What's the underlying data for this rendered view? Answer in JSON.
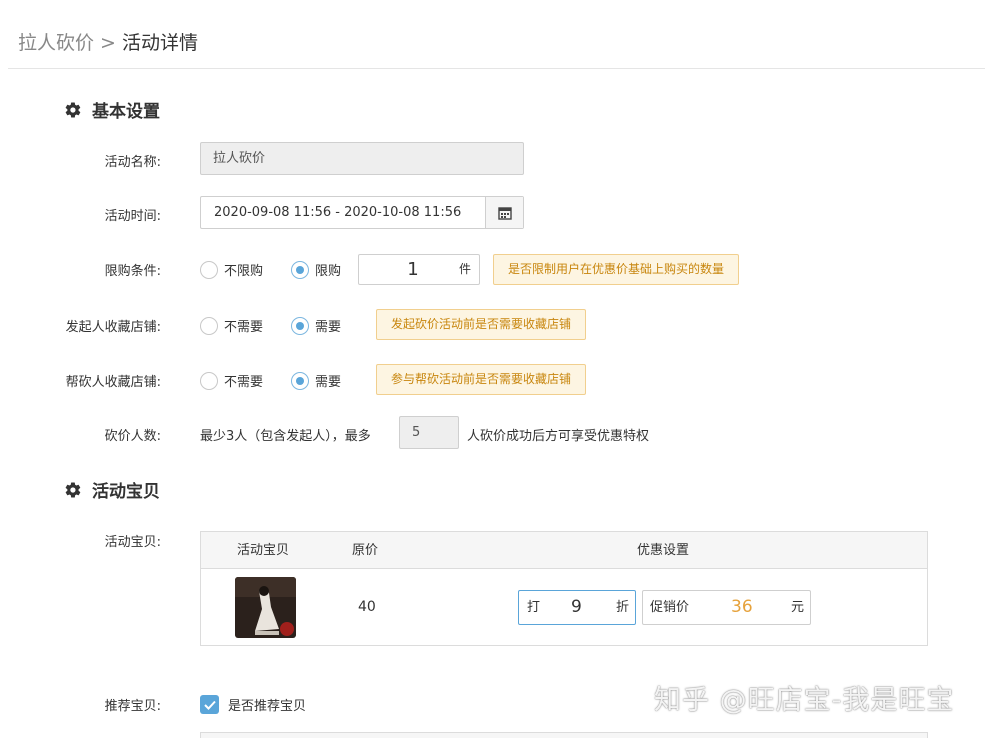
{
  "breadcrumb": {
    "parent": "拉人砍价",
    "separator": ">",
    "current": "活动详情"
  },
  "sections": {
    "basic": "基本设置",
    "goods": "活动宝贝"
  },
  "form": {
    "name_label": "活动名称:",
    "name_value": "拉人砍价",
    "time_label": "活动时间:",
    "time_value": "2020-09-08 11:56 - 2020-10-08 11:56",
    "limit_label": "限购条件:",
    "limit_options": [
      "不限购",
      "限购"
    ],
    "limit_selected": "限购",
    "limit_qty": "1",
    "limit_unit": "件",
    "limit_tip": "是否限制用户在优惠价基础上购买的数量",
    "initiator_fav_label": "发起人收藏店铺:",
    "initiator_fav_options": [
      "不需要",
      "需要"
    ],
    "initiator_fav_selected": "需要",
    "initiator_fav_tip": "发起砍价活动前是否需要收藏店铺",
    "helper_fav_label": "帮砍人收藏店铺:",
    "helper_fav_options": [
      "不需要",
      "需要"
    ],
    "helper_fav_selected": "需要",
    "helper_fav_tip": "参与帮砍活动前是否需要收藏店铺",
    "people_label": "砍价人数:",
    "people_prefix": "最少3人（包含发起人），最多",
    "people_max": "5",
    "people_suffix": "人砍价成功后方可享受优惠特权"
  },
  "goods": {
    "label": "活动宝贝:",
    "columns": [
      "活动宝贝",
      "原价",
      "优惠设置"
    ],
    "rows": [
      {
        "price": "40",
        "discount_prefix": "打",
        "discount_value": "9",
        "discount_suffix": "折",
        "promo_label": "促销价",
        "promo_value": "36",
        "promo_unit": "元"
      }
    ]
  },
  "recommend": {
    "label": "推荐宝贝:",
    "checkbox_label": "是否推荐宝贝",
    "checked": true
  },
  "watermark": "知乎 @旺店宝-我是旺宝",
  "colors": {
    "accent": "#5aa5d9",
    "tip_bg": "#fdf5e2",
    "tip_border": "#f1cf8e",
    "tip_text": "#c8860e",
    "promo_price": "#e6a23c"
  }
}
